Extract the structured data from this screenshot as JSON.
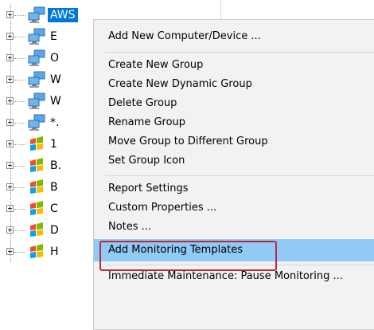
{
  "tree": {
    "items": [
      {
        "label": "AWS",
        "icon": "computers-icon",
        "selected": true
      },
      {
        "label": "E",
        "icon": "computers-icon"
      },
      {
        "label": "O",
        "icon": "computers-icon"
      },
      {
        "label": "W",
        "icon": "computers-icon"
      },
      {
        "label": "W",
        "icon": "computers-icon"
      },
      {
        "label": "*.",
        "icon": "computers-icon"
      },
      {
        "label": "1",
        "icon": "windows-flag-icon"
      },
      {
        "label": "B.",
        "icon": "windows-flag-icon"
      },
      {
        "label": "B",
        "icon": "windows-flag-icon"
      },
      {
        "label": "C",
        "icon": "windows-flag-icon"
      },
      {
        "label": "D",
        "icon": "windows-flag-icon"
      },
      {
        "label": "H",
        "icon": "windows-flag-icon"
      }
    ]
  },
  "context_menu": {
    "items": [
      {
        "label": "Add New Computer/Device ..."
      },
      {
        "label": "Create New Group"
      },
      {
        "label": "Create New Dynamic Group"
      },
      {
        "label": "Delete Group"
      },
      {
        "label": "Rename Group"
      },
      {
        "label": "Move Group to Different Group"
      },
      {
        "label": "Set Group Icon"
      },
      {
        "label": "Report Settings"
      },
      {
        "label": "Custom Properties ..."
      },
      {
        "label": "Notes ..."
      },
      {
        "label": "Add Monitoring Templates",
        "highlighted": true
      },
      {
        "label": "Immediate Maintenance: Pause Monitoring ..."
      }
    ]
  },
  "colors": {
    "selection": "#0078d7",
    "menu_highlight": "#91c9f7",
    "annotation_box": "#b52b3a"
  }
}
